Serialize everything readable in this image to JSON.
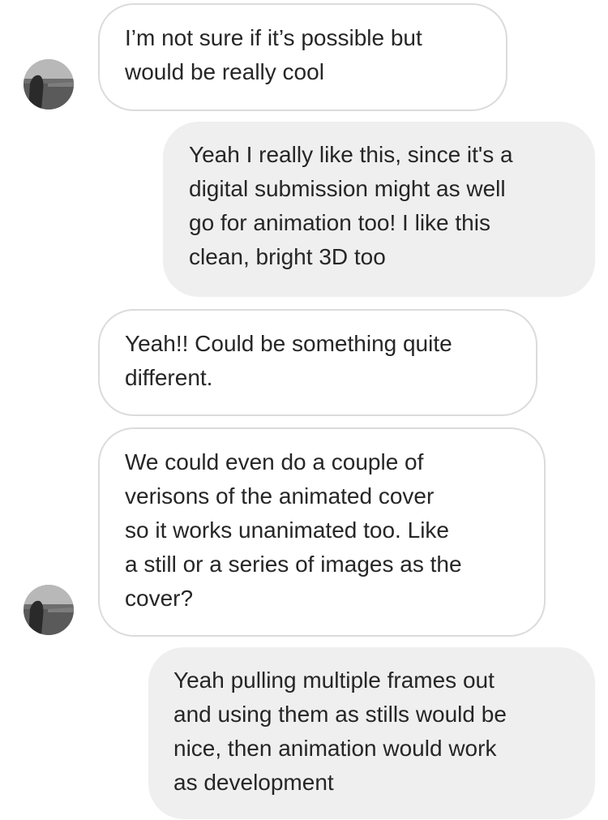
{
  "messages": [
    {
      "sender": "other",
      "text": "I’m not sure if it’s possible but\nwould be really cool",
      "avatar": true
    },
    {
      "sender": "me",
      "text": "Yeah I really like this, since it's a\ndigital submission might as well\ngo for animation too! I like this\nclean, bright 3D too"
    },
    {
      "sender": "other",
      "text": "Yeah!! Could be something quite\ndifferent.",
      "avatar": false
    },
    {
      "sender": "other",
      "text": "We could even do a couple of\nverisons of the animated cover\nso it works unanimated too. Like\na still or a series of images as the\ncover?",
      "avatar": true
    },
    {
      "sender": "me",
      "text": "Yeah pulling multiple frames out\nand using them as stills would be\nnice, then animation would work\nas development"
    }
  ],
  "colors": {
    "incoming_bg": "#ffffff",
    "incoming_border": "#dbdbdb",
    "outgoing_bg": "#efefef",
    "text": "#262626"
  },
  "icons": {
    "avatar": "profile-photo-avatar-icon"
  }
}
